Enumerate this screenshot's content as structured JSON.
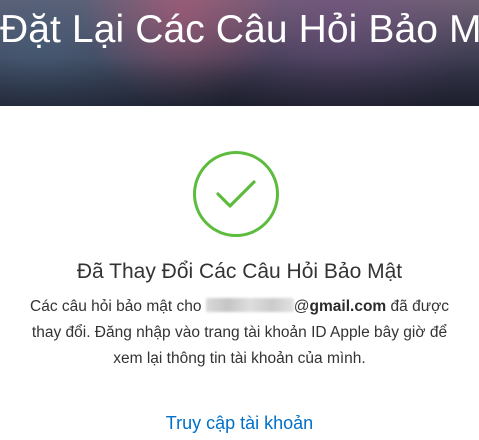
{
  "hero": {
    "title": "Đặt Lại Các Câu Hỏi Bảo Mật"
  },
  "status": {
    "icon": "checkmark-circle-icon",
    "color": "#5dbb3d",
    "headline": "Đã Thay Đổi Các Câu Hỏi Bảo Mật"
  },
  "message": {
    "before_email": "Các câu hỏi bảo mật cho ",
    "email_domain": "gmail.com",
    "after_email": " đã được thay đổi. Đăng nhập vào trang tài khoản ID Apple bây giờ để xem lại thông tin tài khoản của mình."
  },
  "actions": {
    "account_link": "Truy cập tài khoản",
    "link_color": "#0070c9"
  }
}
